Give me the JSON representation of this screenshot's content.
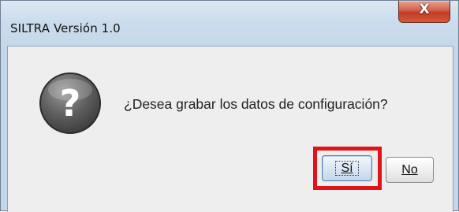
{
  "window": {
    "title": "SILTRA Versión 1.0",
    "close_icon": "close-icon"
  },
  "dialog": {
    "icon": "question-icon",
    "message": "¿Desea grabar los datos de configuración?",
    "buttons": {
      "yes_label": "Sí",
      "no_label": "No"
    }
  },
  "annotation": {
    "highlight_color": "#e0131b",
    "highlighted": "yes-button"
  }
}
